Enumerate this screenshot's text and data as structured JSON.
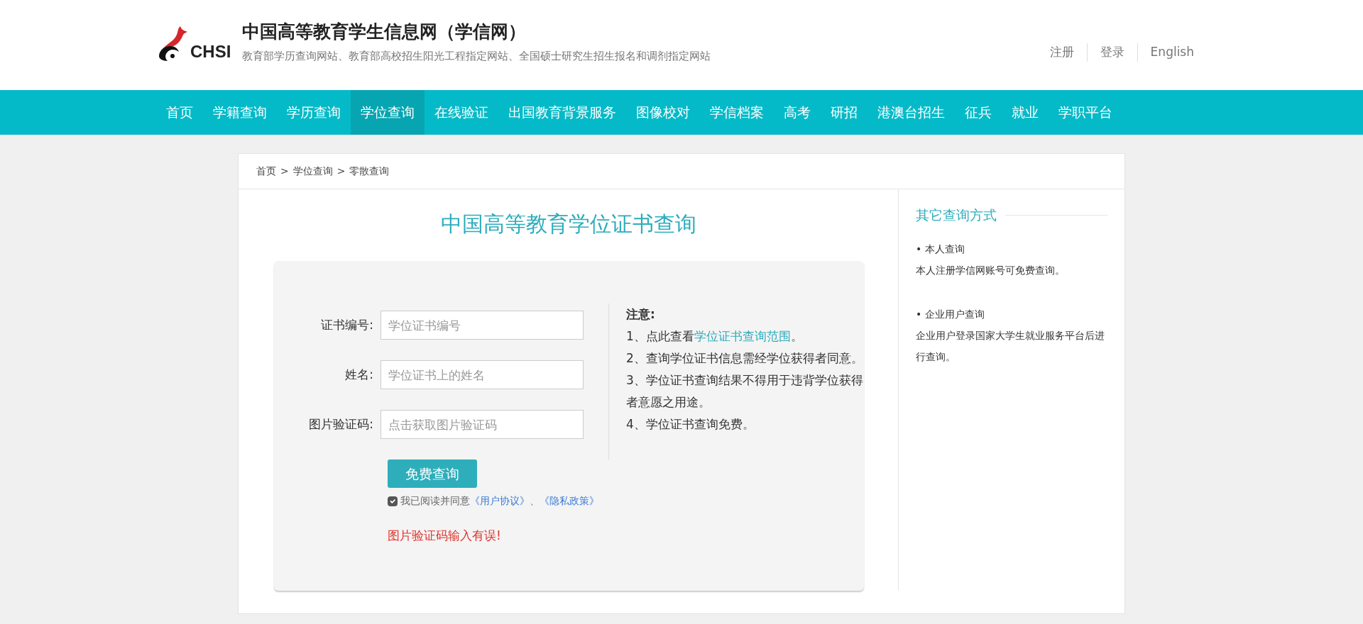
{
  "header": {
    "logo_text": "CHSI",
    "title": "中国高等教育学生信息网（学信网）",
    "subtitle": "教育部学历查询网站、教育部高校招生阳光工程指定网站、全国硕士研究生招生报名和调剂指定网站",
    "links": [
      "注册",
      "登录",
      "English"
    ]
  },
  "nav": [
    {
      "label": "首页",
      "selected": false
    },
    {
      "label": "学籍查询",
      "selected": false
    },
    {
      "label": "学历查询",
      "selected": false
    },
    {
      "label": "学位查询",
      "selected": true
    },
    {
      "label": "在线验证",
      "selected": false
    },
    {
      "label": "出国教育背景服务",
      "selected": false
    },
    {
      "label": "图像校对",
      "selected": false
    },
    {
      "label": "学信档案",
      "selected": false
    },
    {
      "label": "高考",
      "selected": false
    },
    {
      "label": "研招",
      "selected": false
    },
    {
      "label": "港澳台招生",
      "selected": false
    },
    {
      "label": "征兵",
      "selected": false
    },
    {
      "label": "就业",
      "selected": false
    },
    {
      "label": "学职平台",
      "selected": false
    }
  ],
  "breadcrumb": {
    "items": [
      "首页",
      "学位查询",
      "零散查询"
    ],
    "separator": ">"
  },
  "page_title": "中国高等教育学位证书查询",
  "form": {
    "fields": [
      {
        "label": "证书编号:",
        "placeholder": "学位证书编号"
      },
      {
        "label": "姓名:",
        "placeholder": "学位证书上的姓名"
      },
      {
        "label": "图片验证码:",
        "placeholder": "点击获取图片验证码"
      }
    ],
    "submit": "免费查询",
    "agreement": {
      "checked": true,
      "text": "我已阅读并同意",
      "links": [
        "《用户协议》",
        "《隐私政策》"
      ],
      "joiner": "、"
    },
    "error": "图片验证码输入有误!"
  },
  "notice": {
    "title": "注意:",
    "items": [
      {
        "text": "1、点此查看",
        "link": "学位证书查询范围",
        "suffix": "。"
      },
      {
        "text": "2、查询学位证书信息需经学位获得者同意。"
      },
      {
        "text": "3、学位证书查询结果不得用于违背学位获得者意愿之用途。"
      },
      {
        "text": "4、学位证书查询免费。"
      }
    ]
  },
  "sidebar": {
    "title": "其它查询方式",
    "items": [
      {
        "title": "• 本人查询",
        "description": "本人注册学信网账号可免费查询。"
      },
      {
        "title": "• 企业用户查询",
        "description": "企业用户登录国家大学生就业服务平台后进行查询。"
      }
    ]
  }
}
